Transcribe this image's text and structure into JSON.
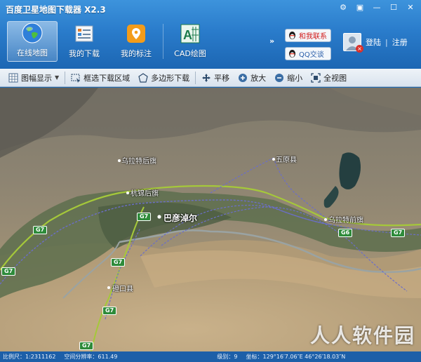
{
  "app": {
    "title": "百度卫星地图下载器 X2.3"
  },
  "window_controls": [
    "settings",
    "menu",
    "minimize",
    "maximize",
    "close"
  ],
  "ribbon": [
    {
      "label": "在线地图",
      "icon": "globe-icon",
      "active": true
    },
    {
      "label": "我的下载",
      "icon": "download-list-icon",
      "active": false
    },
    {
      "label": "我的标注",
      "icon": "map-pin-icon",
      "active": false
    },
    {
      "label": "CAD绘图",
      "icon": "cad-icon",
      "active": false
    }
  ],
  "more": "»",
  "contact": {
    "contact_us": "和我联系",
    "qq_chat": "QQ交谈"
  },
  "user": {
    "login": "登陆",
    "separator": "|",
    "register": "注册"
  },
  "toolbar": {
    "tile_display": "图幅显示",
    "select_download": "框选下载区域",
    "polygon_download": "多边形下载",
    "pan": "平移",
    "zoom_in": "放大",
    "zoom_out": "缩小",
    "full_view": "全视图"
  },
  "map": {
    "places": {
      "wulate_hou": "乌拉特后旗",
      "wuyuan": "五原县",
      "hangjin_hou": "杭锦后旗",
      "bayannaoer": "巴彦淖尔",
      "wulate_qian": "乌拉特前旗",
      "dengkou": "磴口县"
    },
    "highways": {
      "g7_a": "G7",
      "g7_b": "G7",
      "g7_c": "G7",
      "g7_d": "G7",
      "g7_e": "G7",
      "g6": "G6",
      "g7_f": "G7"
    },
    "watermark": "人人软件园"
  },
  "status": {
    "scale": "比例尺：1:2311162",
    "resolution": "空间分辨率：611.49",
    "level": "级别：9",
    "coords": "坐标：129°16′7.06″E  46°26′18.03″N"
  }
}
